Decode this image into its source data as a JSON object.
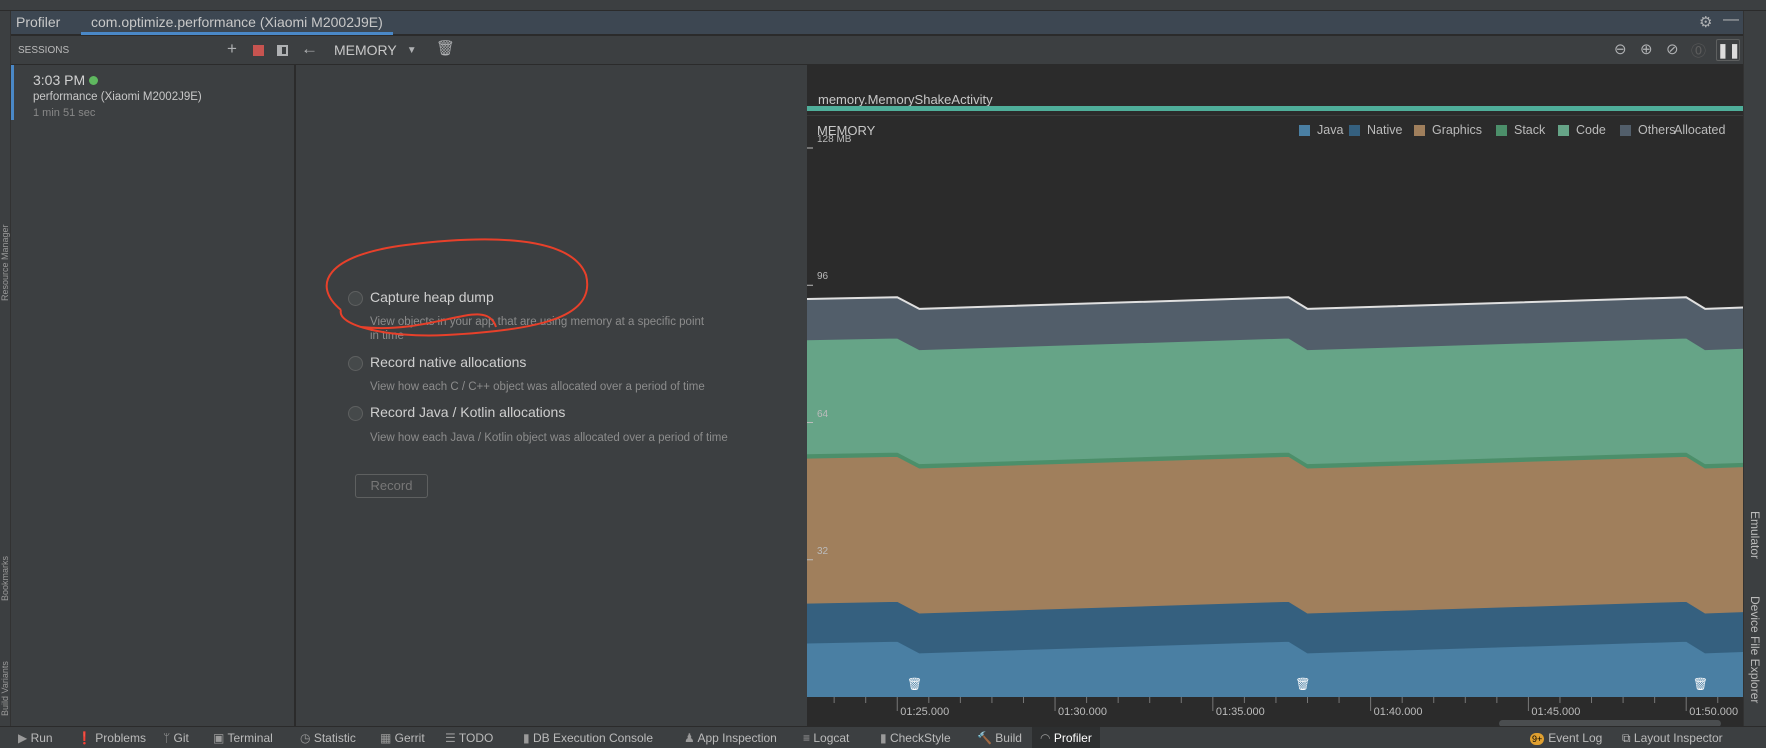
{
  "window": {
    "tool_window": "Profiler",
    "session_tab": "com.optimize.performance (Xiaomi M2002J9E)"
  },
  "left_strip": [
    "Resource Manager",
    "Bookmarks",
    "Build Variants"
  ],
  "right_strip": [
    "Emulator",
    "Device File Explorer"
  ],
  "sessions": {
    "header": "SESSIONS",
    "item": {
      "time": "3:03 PM",
      "name": "performance (Xiaomi M2002J9E)",
      "duration": "1 min 51 sec",
      "status_color": "#5fb85f"
    }
  },
  "toolbar": {
    "profiler_select": "MEMORY"
  },
  "options": [
    {
      "label": "Capture heap dump",
      "desc": "View objects in your app that are using memory at a specific point",
      "desc2": "in time"
    },
    {
      "label": "Record native allocations",
      "desc": "View how each C / C++ object was allocated over a period of time"
    },
    {
      "label": "Record Java / Kotlin allocations",
      "desc": "View how each Java / Kotlin object was allocated over a period of time"
    }
  ],
  "record_button": "Record",
  "activity": "memory.MemoryShakeActivity",
  "chart_data": {
    "type": "area",
    "title": "MEMORY",
    "stacked": true,
    "ylim": [
      0,
      128
    ],
    "yticks": [
      {
        "v": 128,
        "label": "128 MB"
      },
      {
        "v": 96,
        "label": "96"
      },
      {
        "v": 64,
        "label": "64"
      },
      {
        "v": 32,
        "label": "32"
      }
    ],
    "xlim": [
      82.14,
      111.8
    ],
    "xticks": [
      {
        "v": 85,
        "label": "01:25.000"
      },
      {
        "v": 90,
        "label": "01:30.000"
      },
      {
        "v": 95,
        "label": "01:35.000"
      },
      {
        "v": 100,
        "label": "01:40.000"
      },
      {
        "v": 105,
        "label": "01:45.000"
      },
      {
        "v": 110,
        "label": "01:50.000"
      }
    ],
    "x": [
      82.14,
      85.0,
      85.7,
      97.4,
      98.0,
      110.0,
      110.6,
      111.8
    ],
    "series": [
      {
        "name": "Java",
        "color": "#4a7fa3",
        "values": [
          12.6,
          13.0,
          10.3,
          13.0,
          10.3,
          13.0,
          10.3,
          10.6
        ]
      },
      {
        "name": "Native",
        "color": "#35607f",
        "values": [
          9.3,
          9.3,
          9.3,
          9.3,
          9.3,
          9.3,
          9.3,
          9.3
        ]
      },
      {
        "name": "Graphics",
        "color": "#a07f5c",
        "values": [
          33.8,
          33.8,
          33.8,
          33.8,
          33.8,
          33.8,
          33.8,
          33.8
        ]
      },
      {
        "name": "Stack",
        "color": "#4c8f6a",
        "values": [
          1.0,
          1.0,
          1.0,
          1.0,
          1.0,
          1.0,
          1.0,
          1.0
        ]
      },
      {
        "name": "Code",
        "color": "#66a487",
        "values": [
          26.6,
          26.6,
          26.6,
          26.6,
          26.6,
          26.6,
          26.6,
          26.6
        ]
      },
      {
        "name": "Others",
        "color": "#525e6a",
        "values": [
          9.5,
          9.5,
          9.5,
          9.5,
          9.5,
          9.5,
          9.5,
          9.5
        ]
      }
    ],
    "allocated_label": "Allocated",
    "gc_events": [
      85.5,
      97.8,
      110.4
    ]
  },
  "statusbar": {
    "left": [
      "Run",
      "Problems",
      "Git",
      "Terminal",
      "Statistic",
      "Gerrit",
      "TODO",
      "DB Execution Console",
      "App Inspection",
      "Logcat",
      "CheckStyle",
      "Build",
      "Profiler"
    ],
    "right": [
      "Event Log",
      "Layout Inspector"
    ],
    "event_badge": "9+"
  }
}
